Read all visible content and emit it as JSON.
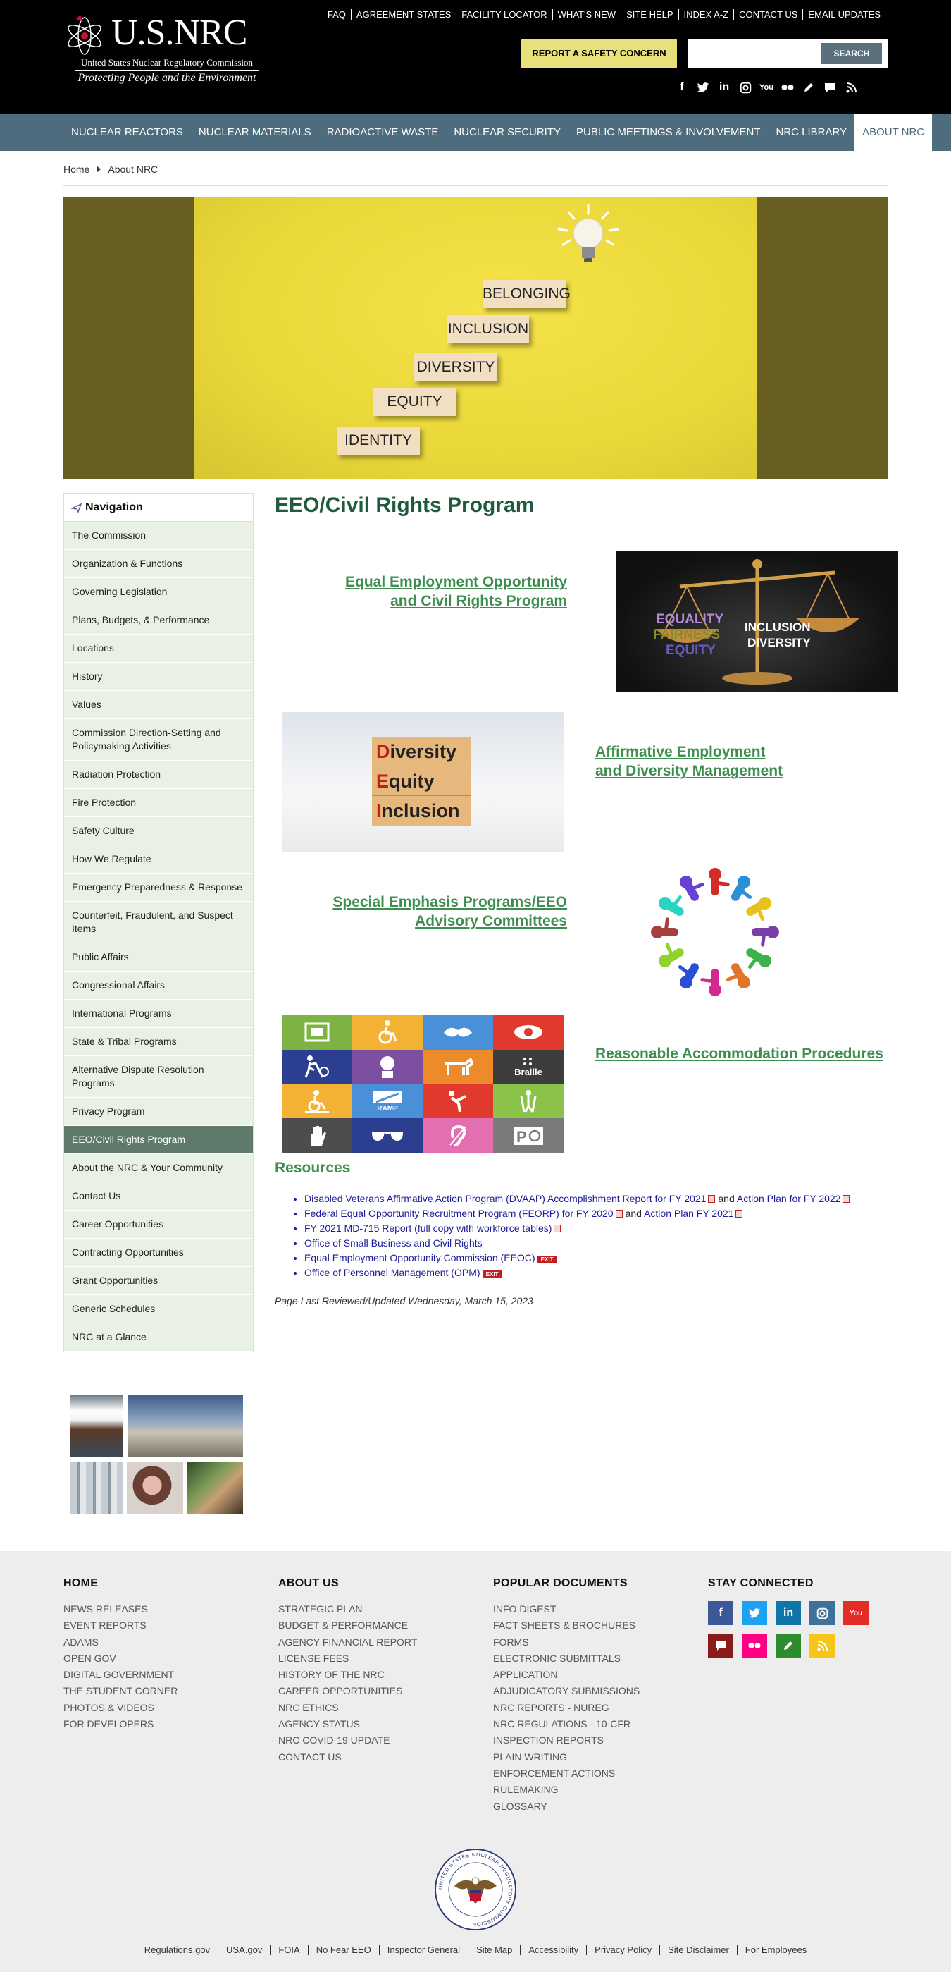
{
  "header": {
    "logo_text": "U.S.NRC",
    "logo_subname": "United States Nuclear Regulatory Commission",
    "tagline": "Protecting People and the Environment",
    "utility_links": [
      "FAQ",
      "AGREEMENT STATES",
      "FACILITY LOCATOR",
      "WHAT'S NEW",
      "SITE HELP",
      "INDEX A-Z",
      "CONTACT US",
      "EMAIL UPDATES"
    ],
    "safety_button": "REPORT A SAFETY CONCERN",
    "search_placeholder": "",
    "search_button": "SEARCH",
    "social_icons": [
      "facebook-icon",
      "twitter-icon",
      "linkedin-icon",
      "instagram-icon",
      "youtube-icon",
      "flickr-icon",
      "blog-icon",
      "chat-icon",
      "rss-icon"
    ]
  },
  "main_nav": {
    "items": [
      "NUCLEAR REACTORS",
      "NUCLEAR MATERIALS",
      "RADIOACTIVE WASTE",
      "NUCLEAR SECURITY",
      "PUBLIC MEETINGS & INVOLVEMENT",
      "NRC LIBRARY",
      "ABOUT NRC"
    ],
    "active": "ABOUT NRC"
  },
  "breadcrumb": [
    "Home",
    "About NRC"
  ],
  "hero": {
    "blocks": [
      "BELONGING",
      "INCLUSION",
      "DIVERSITY",
      "EQUITY",
      "IDENTITY"
    ]
  },
  "sidebar": {
    "heading": "Navigation",
    "items": [
      "The Commission",
      "Organization & Functions",
      "Governing Legislation",
      "Plans, Budgets, & Performance",
      "Locations",
      "History",
      "Values",
      "Commission Direction-Setting and Policymaking Activities",
      "Radiation Protection",
      "Fire Protection",
      "Safety Culture",
      "How We Regulate",
      "Emergency Preparedness & Response",
      "Counterfeit, Fraudulent, and Suspect Items",
      "Public Affairs",
      "Congressional Affairs",
      "International Programs",
      "State & Tribal Programs",
      "Alternative Dispute Resolution Programs",
      "Privacy Program",
      "EEO/Civil Rights Program",
      "About the NRC & Your Community",
      "Contact Us",
      "Career Opportunities",
      "Contracting Opportunities",
      "Grant Opportunities",
      "Generic Schedules",
      "NRC at a Glance"
    ],
    "active": "EEO/Civil Rights Program"
  },
  "content": {
    "title": "EEO/Civil Rights Program",
    "programs": [
      {
        "line1": "Equal Employment Opportunity",
        "line2": "and Civil Rights Program"
      },
      {
        "line1": "Affirmative Employment",
        "line2": "and Diversity Management"
      },
      {
        "line1": "Special Emphasis Programs/EEO",
        "line2": "Advisory Committees"
      },
      {
        "line1": "Reasonable Accommodation Procedures",
        "line2": ""
      }
    ],
    "scale_image": {
      "left": "EQUALITY",
      "left2": "FAIRNESS",
      "left3": "EQUITY",
      "right": "INCLUSION",
      "right2": "DIVERSITY"
    },
    "dei_image": {
      "d": "D",
      "d_rest": "iversity",
      "e": "E",
      "e_rest": "quity",
      "i": "I",
      "i_rest": "nclusion"
    },
    "accessibility_image": {
      "ramp": "RAMP",
      "braille": "Braille"
    },
    "resources_heading": "Resources",
    "resources": [
      {
        "text": "Disabled Veterans Affirmative Action Program (DVAAP) Accomplishment Report for FY 2021",
        "joiner": "and",
        "second": "Action Plan for FY 2022"
      },
      {
        "text": "Federal Equal Opportunity Recruitment Program (FEORP) for FY 2020",
        "joiner": "and",
        "second": "Action Plan FY 2021"
      },
      {
        "text": "FY 2021 MD-715 Report (full copy with workforce tables)",
        "joiner": "",
        "second": ""
      },
      {
        "text": "Office of Small Business and Civil Rights",
        "joiner": "",
        "second": ""
      },
      {
        "text": "Equal Employment Opportunity Commission (EEOC)",
        "joiner": "",
        "second": ""
      },
      {
        "text": "Office of Personnel Management (OPM)",
        "joiner": "",
        "second": ""
      }
    ],
    "exit_label": "EXIT",
    "last_reviewed": "Page Last Reviewed/Updated Wednesday, March 15, 2023"
  },
  "footer": {
    "col1": {
      "heading": "HOME",
      "links": [
        "NEWS RELEASES",
        "EVENT REPORTS",
        "ADAMS",
        "OPEN GOV",
        "DIGITAL GOVERNMENT",
        "THE STUDENT CORNER",
        "PHOTOS & VIDEOS",
        "FOR DEVELOPERS"
      ]
    },
    "col2": {
      "heading": "ABOUT US",
      "links": [
        "STRATEGIC PLAN",
        "BUDGET & PERFORMANCE",
        "AGENCY FINANCIAL REPORT",
        "LICENSE FEES",
        "HISTORY OF THE NRC",
        "CAREER OPPORTUNITIES",
        "NRC ETHICS",
        "AGENCY STATUS",
        "NRC COVID-19 UPDATE",
        "CONTACT US"
      ]
    },
    "col3": {
      "heading": "POPULAR DOCUMENTS",
      "links": [
        "INFO DIGEST",
        "FACT SHEETS & BROCHURES",
        "FORMS",
        "ELECTRONIC SUBMITTALS",
        "APPLICATION",
        "ADJUDICATORY SUBMISSIONS",
        "NRC REPORTS - NUREG",
        "NRC REGULATIONS - 10-CFR",
        "INSPECTION REPORTS",
        "PLAIN WRITING",
        "ENFORCEMENT ACTIONS",
        "RULEMAKING",
        "GLOSSARY"
      ]
    },
    "stay_connected": {
      "heading": "STAY CONNECTED"
    },
    "seal_text": "UNITED STATES NUCLEAR REGULATORY COMMISSION",
    "bottom_links": [
      "Regulations.gov",
      "USA.gov",
      "FOIA",
      "No Fear EEO",
      "Inspector General",
      "Site Map",
      "Accessibility",
      "Privacy Policy",
      "Site Disclaimer",
      "For Employees"
    ]
  },
  "colors": {
    "nav_bg": "#4d6c7e",
    "heading_green": "#1f5c3e",
    "link_green": "#3e8f4f",
    "sidebar_bg": "#e9f1e4",
    "sidebar_active": "#5f7a6a",
    "safety_button_bg": "#e8e07a"
  }
}
